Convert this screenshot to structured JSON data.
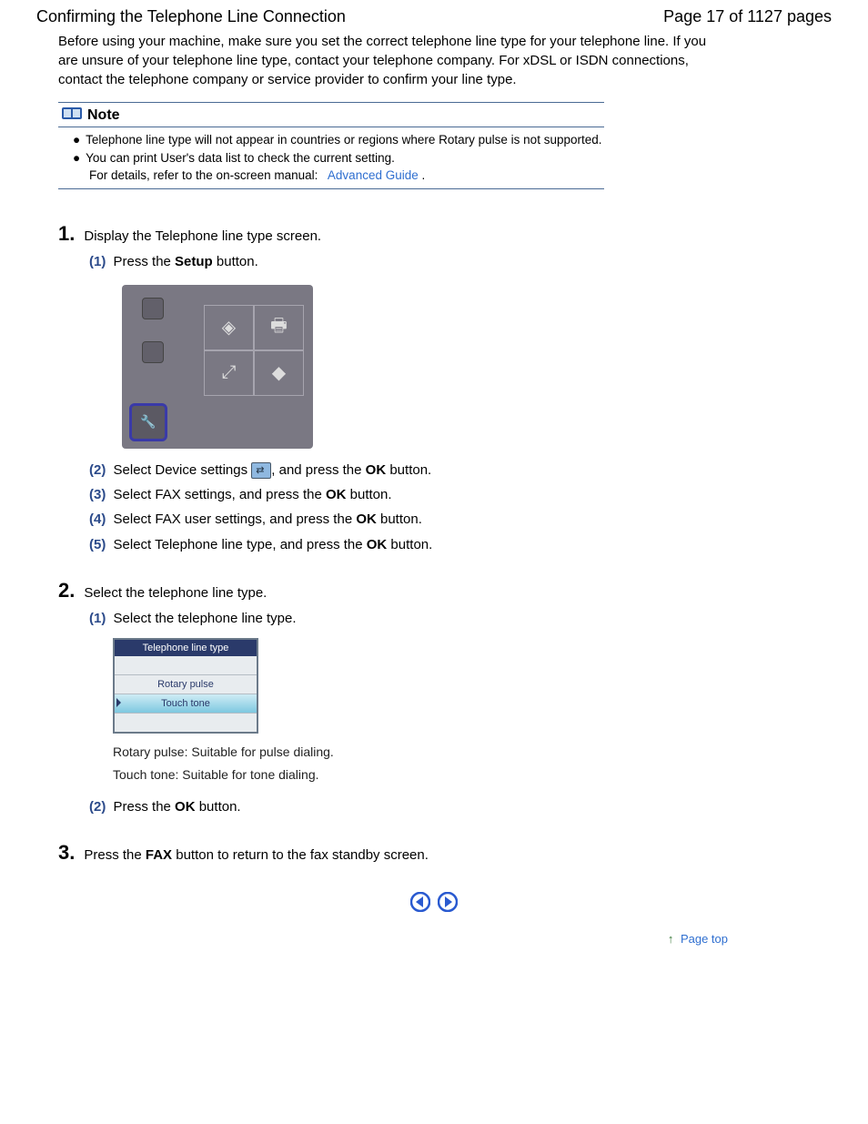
{
  "header": {
    "title": "Confirming the Telephone Line Connection",
    "page_indicator": "Page 17 of 1127 pages"
  },
  "intro": "Before using your machine, make sure you set the correct telephone line type for your telephone line. If you are unsure of your telephone line type, contact your telephone company. For xDSL or ISDN connections, contact the telephone company or service provider to confirm your line type.",
  "note": {
    "label": "Note",
    "bullet1": "Telephone line type will not appear in countries or regions where Rotary pulse is not supported.",
    "bullet2": "You can print User's data list to check the current setting.",
    "details_prefix": "For details, refer to the on-screen manual:",
    "link": "Advanced Guide",
    "period": "."
  },
  "steps": {
    "s1": {
      "num": "1.",
      "text": "Display the Telephone line type screen.",
      "sub1_num": "(1)",
      "sub1_a": "Press the ",
      "sub1_bold": "Setup",
      "sub1_b": " button.",
      "sub2_num": "(2)",
      "sub2_a": "Select Device settings ",
      "sub2_b": ", and press the ",
      "sub2_bold": "OK",
      "sub2_c": " button.",
      "sub3_num": "(3)",
      "sub3_a": "Select FAX settings, and press the ",
      "sub3_bold": "OK",
      "sub3_b": " button.",
      "sub4_num": "(4)",
      "sub4_a": "Select FAX user settings, and press the ",
      "sub4_bold": "OK",
      "sub4_b": " button.",
      "sub5_num": "(5)",
      "sub5_a": "Select Telephone line type, and press the ",
      "sub5_bold": "OK",
      "sub5_b": " button."
    },
    "s2": {
      "num": "2.",
      "text": "Select the telephone line type.",
      "sub1_num": "(1)",
      "sub1": "Select the telephone line type.",
      "lcd_title": "Telephone line type",
      "lcd_opt1": "Rotary pulse",
      "lcd_opt2": "Touch tone",
      "desc1": "Rotary pulse: Suitable for pulse dialing.",
      "desc2": "Touch tone: Suitable for tone dialing.",
      "sub2_num": "(2)",
      "sub2_a": "Press the ",
      "sub2_bold": "OK",
      "sub2_b": " button."
    },
    "s3": {
      "num": "3.",
      "text_a": "Press the ",
      "text_bold": "FAX",
      "text_b": " button to return to the fax standby screen."
    }
  },
  "footer": {
    "page_top": "Page top"
  }
}
